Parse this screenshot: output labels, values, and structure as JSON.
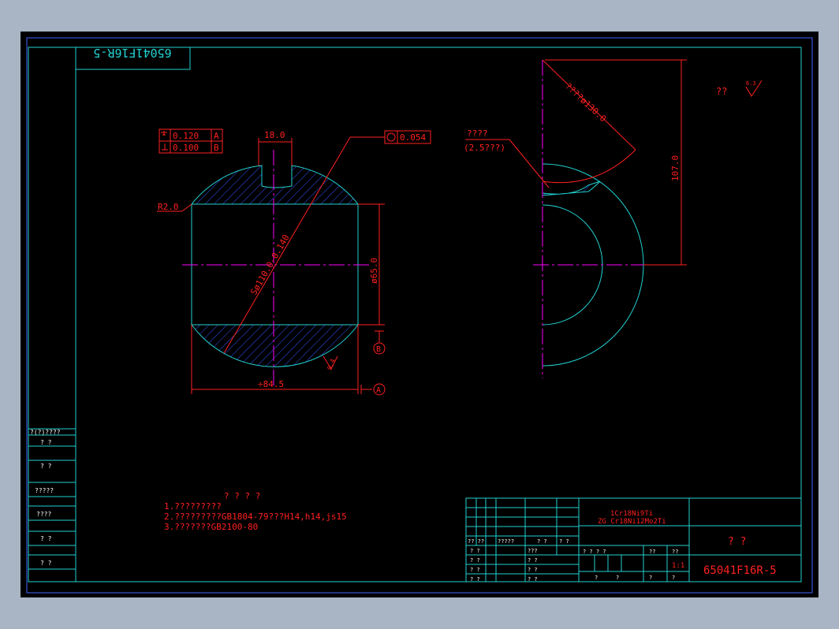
{
  "title_block_rotated": "65041F16R-5",
  "tolerances": {
    "flatness_value": "0.120",
    "flatness_datum": "A",
    "perp_value": "0.100",
    "perp_datum": "B",
    "roundness_value": "0.054"
  },
  "front_view": {
    "slot_width": "18.0",
    "fillet": "R2.0",
    "sphere_dia": "Sø110.0-0.140",
    "bore_dia": "ø65.0",
    "width": "÷84.5",
    "datum_a": "A",
    "datum_b": "B",
    "roughness_side": "0.4"
  },
  "side_view": {
    "note_top": "????",
    "note_bottom": "(2.5???)",
    "dia_label": "????ø130.0",
    "height": "107.0"
  },
  "roughness_corner": {
    "label": "??",
    "value": "6.3"
  },
  "notes": {
    "title": "? ? ? ?",
    "lines": [
      "1.?????????",
      "2.?????????GB1804-79???H14,h14,js15",
      "3.???????GB2100-80"
    ]
  },
  "left_strip": [
    "?(?)????",
    "?  ?",
    "?  ?",
    "?????",
    "????",
    "?  ?",
    "?  ?"
  ],
  "title_block": {
    "material_1": "1Cr18Ni9Ti",
    "material_2": "ZG  Cr18Ni12Mo2Ti",
    "name": "?  ?",
    "drawing_no": "65041F16R-5",
    "scale": "1:1",
    "row_labels": [
      "??  ??",
      "?????",
      "?  ?",
      "?  ?"
    ],
    "left_rows": [
      "?  ?",
      "?  ?",
      "?  ?",
      "?  ?"
    ],
    "mid_rows": [
      "???",
      "?  ?",
      "?  ?",
      "?  ?"
    ],
    "stage_label": "?  ?  ?  ?",
    "weight_label": "??",
    "scale_label": "??",
    "bottom_labels": [
      "?",
      "?",
      "?",
      "?"
    ]
  }
}
